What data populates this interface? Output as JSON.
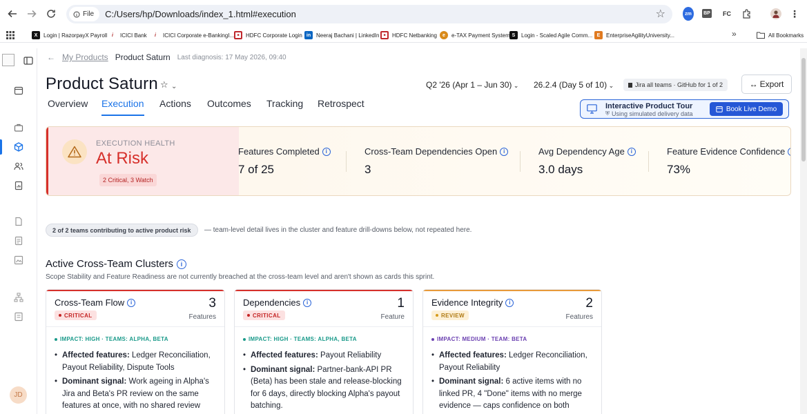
{
  "browser": {
    "file_chip": "File",
    "url": "C:/Users/hp/Downloads/index_1.html#execution",
    "extensions": [
      "zm",
      "BP",
      "FC"
    ],
    "bookmarks": [
      {
        "label": "Login | RazorpayX Payroll",
        "icon": "X",
        "color": "#111111"
      },
      {
        "label": "ICICI Bank",
        "icon": "i",
        "color": "#b02a2a"
      },
      {
        "label": "ICICI Corporate e-BankingI...",
        "icon": "i",
        "color": "#b02a2a"
      },
      {
        "label": "HDFC Corporate  Login",
        "icon": "■",
        "color": "#c0282d"
      },
      {
        "label": "Neeraj Bachani | LinkedIn",
        "icon": "in",
        "color": "#0a66c2"
      },
      {
        "label": "HDFC Netbanking",
        "icon": "■",
        "color": "#c0282d"
      },
      {
        "label": "e-TAX Payment System",
        "icon": "e",
        "color": "#d98a1a"
      },
      {
        "label": "Login - Scaled Agile Comm...",
        "icon": "S",
        "color": "#111111"
      },
      {
        "label": "EnterpriseAgilityUniversity...",
        "icon": "E",
        "color": "#e07a20"
      }
    ],
    "all_bookmarks": "All Bookmarks"
  },
  "sidebar": {
    "avatar": "JD"
  },
  "header": {
    "breadcrumb_link": "My Products",
    "breadcrumb_current": "Product Saturn",
    "last_diagnosis": "Last diagnosis: 17 May 2026, 09:40",
    "title": "Product Saturn",
    "quarter": "Q2 '26 (Apr 1 – Jun 30)",
    "release": "26.2.4 (Day 5 of 10)",
    "jira_chip": "Jira all teams · GitHub for 1 of 2",
    "export": "Export"
  },
  "tabs": [
    "Overview",
    "Execution",
    "Actions",
    "Outcomes",
    "Tracking",
    "Retrospect"
  ],
  "tour": {
    "title": "Interactive Product Tour",
    "subtitle": "Using simulated delivery data",
    "button": "Book Live Demo"
  },
  "health": {
    "label": "EXECUTION HEALTH",
    "status": "At Risk",
    "note": "2 Critical, 3 Watch",
    "status_color": "#d6302b",
    "metrics": [
      {
        "label": "Features Completed",
        "value": "7 of 25"
      },
      {
        "label": "Cross-Team Dependencies Open",
        "value": "3"
      },
      {
        "label": "Avg Dependency Age",
        "value": "3.0 days"
      },
      {
        "label": "Feature Evidence Confidence",
        "value": "73%"
      }
    ]
  },
  "contrib": {
    "chip": "2 of 2 teams contributing to active product risk",
    "text": "— team-level detail lives in the cluster and feature drill-downs below, not repeated here."
  },
  "clusters": {
    "title": "Active Cross-Team Clusters",
    "subtitle": "Scope Stability and Feature Readiness are not currently breached at the cross-team level and aren't shown as cards this sprint.",
    "cards": [
      {
        "name": "Cross-Team Flow",
        "badge": "CRITICAL",
        "count": "3",
        "count_label": "Features",
        "impact": "IMPACT: HIGH · TEAMS: ALPHA, BETA",
        "affected_label": "Affected features:",
        "affected": "Ledger Reconciliation, Payout Reliability, Dispute Tools",
        "signal_label": "Dominant signal:",
        "signal": "Work ageing in Alpha's Jira and Beta's PR review on the same features at once, with no shared review"
      },
      {
        "name": "Dependencies",
        "badge": "CRITICAL",
        "count": "1",
        "count_label": "Feature",
        "impact": "IMPACT: HIGH · TEAMS: ALPHA, BETA",
        "affected_label": "Affected features:",
        "affected": "Payout Reliability",
        "signal_label": "Dominant signal:",
        "signal": "Partner-bank-API PR (Beta) has been stale and release-blocking for 6 days, directly blocking Alpha's payout batching."
      },
      {
        "name": "Evidence Integrity",
        "badge": "REVIEW",
        "count": "2",
        "count_label": "Features",
        "impact": "IMPACT: MEDIUM · TEAM: BETA",
        "affected_label": "Affected features:",
        "affected": "Ledger Reconciliation, Payout Reliability",
        "signal_label": "Dominant signal:",
        "signal": "6 active items with no linked PR, 4 \"Done\" items with no merge evidence — caps confidence on both"
      }
    ]
  },
  "colors": {
    "accent": "#1a73e8",
    "critical": "#d6302b",
    "review": "#d69a1a",
    "impact_teal": "#1a9a8a",
    "impact_purple": "#6a3fb0"
  }
}
